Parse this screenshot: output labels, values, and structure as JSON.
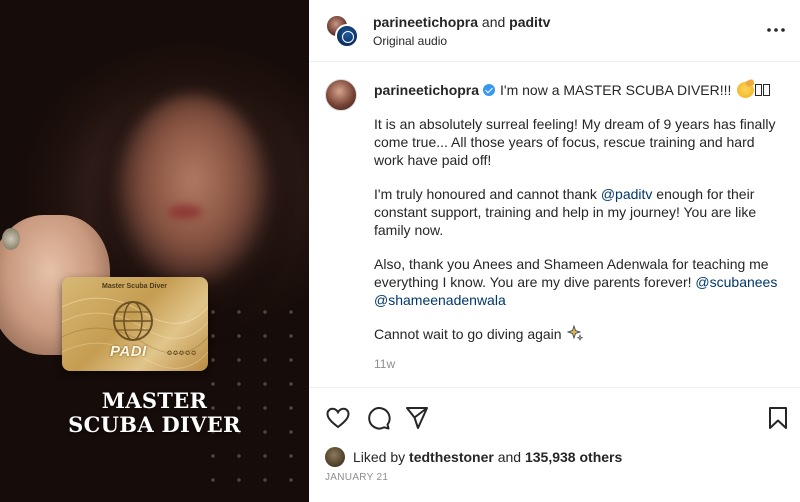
{
  "media": {
    "card_title": "Master Scuba Diver",
    "card_brand": "PADI",
    "card_stars": "✪✪✪✪✪",
    "caption_line1": "MASTER",
    "caption_line2": "SCUBA DIVER"
  },
  "header": {
    "user1": "parineetichopra",
    "joiner": " and ",
    "user2": "paditv",
    "subtitle": "Original audio",
    "more_icon": "more-horizontal-icon"
  },
  "caption": {
    "username": "parineetichopra",
    "headline": "I'm now a MASTER SCUBA DIVER!!!",
    "para1": "It is an absolutely surreal feeling! My dream of 9 years has finally come true... All those years of focus, rescue training and hard work have paid off!",
    "para2_before": "I'm truly honoured and cannot thank ",
    "para2_mention": "@paditv",
    "para2_after": " enough for their constant support, training and help in my journey! You are like family now.",
    "para3_before": "Also, thank you Anees and Shameen Adenwala for teaching me everything I know. You are my dive parents forever! ",
    "para3_mention1": "@scubanees",
    "para3_mention2": "@shameenadenwala",
    "para4": "Cannot wait to go diving again",
    "timestamp": "11w"
  },
  "actions": {
    "like_icon": "heart-icon",
    "comment_icon": "comment-icon",
    "share_icon": "send-icon",
    "save_icon": "bookmark-icon"
  },
  "likes": {
    "prefix": "Liked by ",
    "user": "tedthestoner",
    "middle": " and ",
    "count": "135,938 others"
  },
  "post_date": "JANUARY 21",
  "colors": {
    "verified": "#3897f0",
    "mention": "#00376b",
    "muted": "#8e8e8e",
    "text": "#262626"
  }
}
